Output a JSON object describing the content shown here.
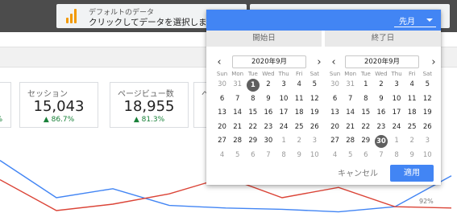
{
  "data_source": {
    "line1": "デフォルトのデータ",
    "line2": "クリックしてデータを選択します"
  },
  "scorecards": [
    {
      "label": "",
      "value": "",
      "delta": "%"
    },
    {
      "label": "セッション",
      "value": "15,043",
      "delta": "▲ 86.7%"
    },
    {
      "label": "ページビュー数",
      "value": "18,955",
      "delta": "▲ 81.3%"
    },
    {
      "label": "ペ",
      "value": "",
      "delta": ""
    }
  ],
  "chart_data": {
    "type": "line",
    "series": [
      {
        "color": "#4285f4",
        "values": [
          88,
          30,
          44,
          18,
          14,
          12,
          8,
          16,
          64
        ]
      },
      {
        "color": "#db4437",
        "values": [
          58,
          10,
          20,
          36,
          62,
          30,
          46,
          16,
          14
        ]
      }
    ],
    "ytick_visible": "92%"
  },
  "date_picker": {
    "preset": "先月",
    "start_label": "開始日",
    "end_label": "終了日",
    "cancel_label": "キャンセル",
    "apply_label": "適用",
    "accent_color": "#4285f4",
    "weekdays": [
      "Sun",
      "Mon",
      "Tue",
      "Wed",
      "Thu",
      "Fri",
      "Sat"
    ],
    "start": {
      "month": "2020年9月",
      "selected": 1,
      "weeks": [
        [
          "30",
          "31",
          "1",
          "2",
          "3",
          "4",
          "5"
        ],
        [
          "6",
          "7",
          "8",
          "9",
          "10",
          "11",
          "12"
        ],
        [
          "13",
          "14",
          "15",
          "16",
          "17",
          "18",
          "19"
        ],
        [
          "20",
          "21",
          "22",
          "23",
          "24",
          "25",
          "26"
        ],
        [
          "27",
          "28",
          "29",
          "30",
          "1",
          "2",
          "3"
        ],
        [
          "4",
          "5",
          "6",
          "7",
          "8",
          "9",
          "10"
        ]
      ]
    },
    "end": {
      "month": "2020年9月",
      "selected": 30,
      "weeks": [
        [
          "30",
          "31",
          "1",
          "2",
          "3",
          "4",
          "5"
        ],
        [
          "6",
          "7",
          "8",
          "9",
          "10",
          "11",
          "12"
        ],
        [
          "13",
          "14",
          "15",
          "16",
          "17",
          "18",
          "19"
        ],
        [
          "20",
          "21",
          "22",
          "23",
          "24",
          "25",
          "26"
        ],
        [
          "27",
          "28",
          "29",
          "30",
          "1",
          "2",
          "3"
        ],
        [
          "4",
          "5",
          "6",
          "7",
          "8",
          "9",
          "10"
        ]
      ]
    }
  }
}
